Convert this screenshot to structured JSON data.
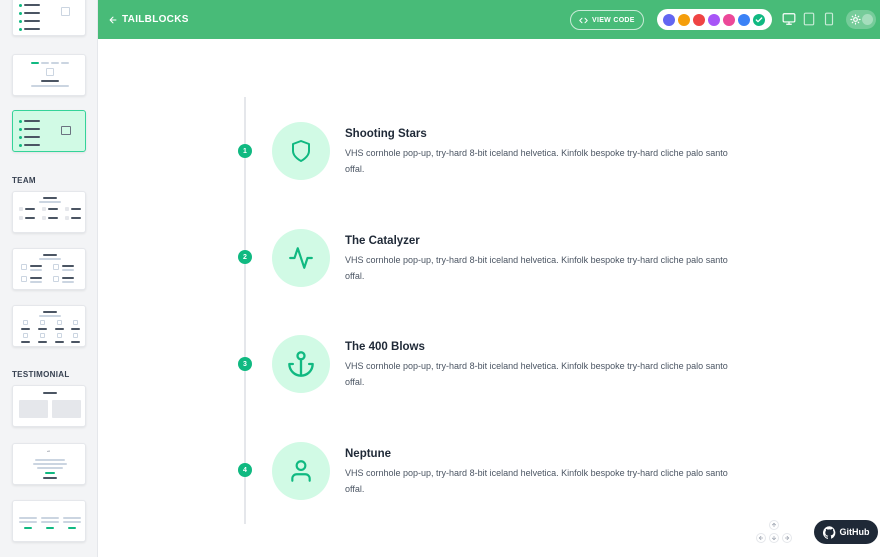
{
  "topbar": {
    "brand": "TAILBLOCKS",
    "view_code": "VIEW CODE",
    "colors": [
      "#6366f1",
      "#f59e0b",
      "#ef4444",
      "#a855f7",
      "#ec4899",
      "#3b82f6",
      "#10b981"
    ],
    "selected_color": "#10b981",
    "bar_color": "#48bb78"
  },
  "sidebar": {
    "sections": [
      {
        "label": "TEAM"
      },
      {
        "label": "TESTIMONIAL"
      }
    ]
  },
  "steps": [
    {
      "number": "1",
      "title": "Shooting Stars",
      "desc": "VHS cornhole pop-up, try-hard 8-bit iceland helvetica. Kinfolk bespoke try-hard cliche palo santo offal.",
      "icon": "shield-icon"
    },
    {
      "number": "2",
      "title": "The Catalyzer",
      "desc": "VHS cornhole pop-up, try-hard 8-bit iceland helvetica. Kinfolk bespoke try-hard cliche palo santo offal.",
      "icon": "activity-icon"
    },
    {
      "number": "3",
      "title": "The 400 Blows",
      "desc": "VHS cornhole pop-up, try-hard 8-bit iceland helvetica. Kinfolk bespoke try-hard cliche palo santo offal.",
      "icon": "anchor-icon"
    },
    {
      "number": "4",
      "title": "Neptune",
      "desc": "VHS cornhole pop-up, try-hard 8-bit iceland helvetica. Kinfolk bespoke try-hard cliche palo santo offal.",
      "icon": "user-icon"
    }
  ],
  "github": {
    "label": "GitHub"
  }
}
